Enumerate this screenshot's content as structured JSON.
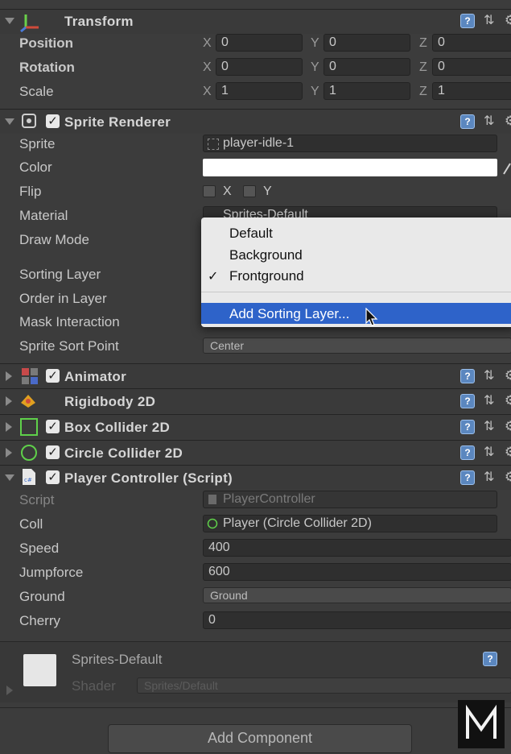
{
  "transform": {
    "title": "Transform",
    "rows": [
      {
        "label": "Position",
        "x": "0",
        "y": "0",
        "z": "0"
      },
      {
        "label": "Rotation",
        "x": "0",
        "y": "0",
        "z": "0"
      },
      {
        "label": "Scale",
        "x": "1",
        "y": "1",
        "z": "1"
      }
    ],
    "axes": {
      "x": "X",
      "y": "Y",
      "z": "Z"
    }
  },
  "sprite_renderer": {
    "title": "Sprite Renderer",
    "sprite_label": "Sprite",
    "sprite_value": "player-idle-1",
    "color_label": "Color",
    "color_value": "#ffffff",
    "flip_label": "Flip",
    "flip_x": "X",
    "flip_y": "Y",
    "material_label": "Material",
    "material_value": "Sprites-Default",
    "draw_mode_label": "Draw Mode",
    "sorting_layer_label": "Sorting Layer",
    "order_label": "Order in Layer",
    "mask_label": "Mask Interaction",
    "sort_point_label": "Sprite Sort Point",
    "sort_point_value": "Center"
  },
  "sorting_popup": {
    "items": [
      "Default",
      "Background",
      "Frontground"
    ],
    "checked_mark": "✓",
    "action": "Add Sorting Layer..."
  },
  "components": [
    {
      "title": "Animator"
    },
    {
      "title": "Rigidbody 2D"
    },
    {
      "title": "Box Collider 2D"
    },
    {
      "title": "Circle Collider 2D"
    }
  ],
  "player_controller": {
    "title": "Player Controller (Script)",
    "script_label": "Script",
    "script_value": "PlayerController",
    "coll_label": "Coll",
    "coll_value": "Player (Circle Collider 2D)",
    "speed_label": "Speed",
    "speed_value": "400",
    "jump_label": "Jumpforce",
    "jump_value": "600",
    "ground_label": "Ground",
    "ground_value": "Ground",
    "cherry_label": "Cherry",
    "cherry_value": "0"
  },
  "material_asset": {
    "name": "Sprites-Default",
    "shader_label": "Shader",
    "shader_value": "Sprites/Default"
  },
  "add_component_label": "Add Component",
  "watermark": "M"
}
